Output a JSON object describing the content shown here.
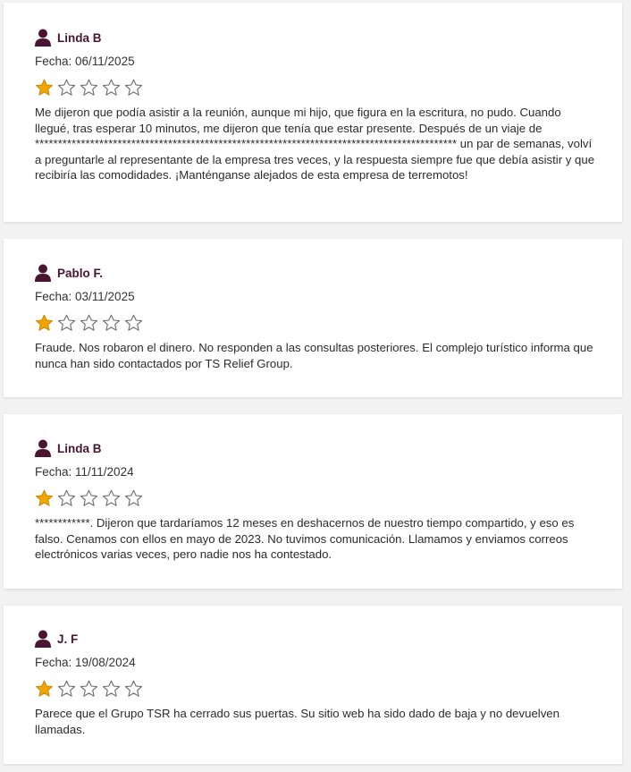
{
  "colors": {
    "star_filled": "#f0a500",
    "star_outline": "#6b6b6b",
    "author_icon": "#4a1530"
  },
  "reviews": [
    {
      "author": "Linda B",
      "date": "Fecha: 06/11/2025",
      "rating": 1,
      "max_rating": 5,
      "text": "Me dijeron que podía asistir a la reunión, aunque mi hijo, que figura en la escritura, no pudo. Cuando llegué, tras esperar 10 minutos, me dijeron que tenía que estar presente. Después de un viaje de ******************************************************************************************** un par de semanas, volví a preguntarle al representante de la empresa tres veces, y la respuesta siempre fue que debía asistir y que recibiría las comodidades. ¡Manténganse alejados de esta empresa de terremotos!"
    },
    {
      "author": "Pablo F.",
      "date": "Fecha: 03/11/2025",
      "rating": 1,
      "max_rating": 5,
      "text": "Fraude. Nos robaron el dinero. No responden a las consultas posteriores. El complejo turístico informa que nunca han sido contactados por TS Relief Group."
    },
    {
      "author": "Linda B",
      "date": "Fecha: 11/11/2024",
      "rating": 1,
      "max_rating": 5,
      "text": "************. Dijeron que tardaríamos 12 meses en deshacernos de nuestro tiempo compartido, y eso es falso. Cenamos con ellos en mayo de 2023. No tuvimos comunicación. Llamamos y enviamos correos electrónicos varias veces, pero nadie nos ha contestado."
    },
    {
      "author": "J. F",
      "date": "Fecha: 19/08/2024",
      "rating": 1,
      "max_rating": 5,
      "text": "Parece que el Grupo TSR ha cerrado sus puertas. Su sitio web ha sido dado de baja y no devuelven llamadas."
    }
  ]
}
